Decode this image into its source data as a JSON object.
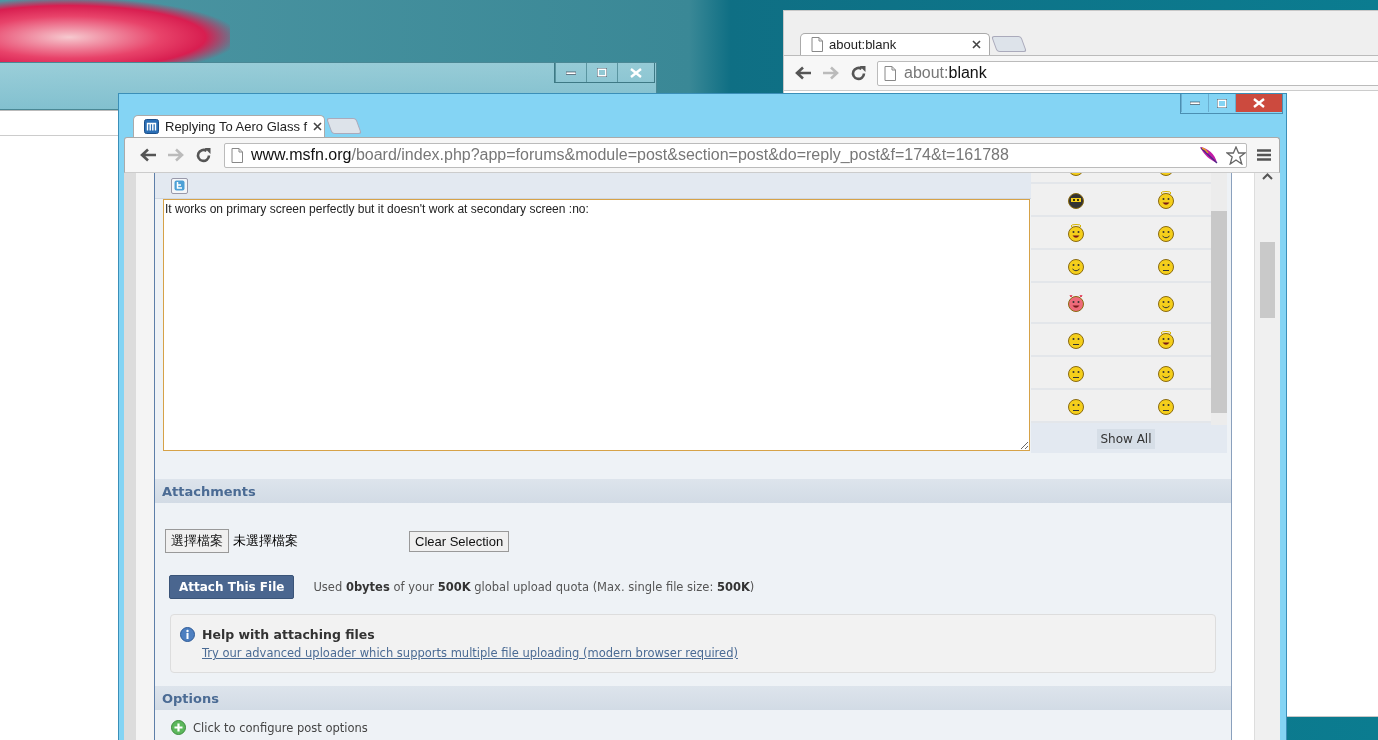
{
  "blank_window": {
    "tab": {
      "title": "about:blank",
      "selected": true
    },
    "address": {
      "scheme": "about:",
      "rest": "blank"
    }
  },
  "main_window": {
    "tab": {
      "title": "Replying To Aero Glass f",
      "selected": true
    },
    "address": {
      "host": "www.msfn.org",
      "path": "/board/index.php?app=forums&module=post&section=post&do=reply_post&f=174&t=161788"
    }
  },
  "editor": {
    "value": "It works on primary screen perfectly but it doesn't work at secondary screen :no: ",
    "focused": true
  },
  "emoticons": {
    "show_all": "Show All"
  },
  "attachments": {
    "heading": "Attachments",
    "choose_button": "選擇檔案",
    "no_file": "未選擇檔案",
    "clear_button": "Clear Selection",
    "attach_button": "Attach This File",
    "quota": "Used **0bytes** of your **500K** global upload quota (Max. single file size: **500K**)",
    "help": {
      "title": "Help with attaching files",
      "link": "Try our advanced uploader which supports multiple file uploading (modern browser required)"
    }
  },
  "options": {
    "heading": "Options",
    "configure": "Click to configure post options"
  }
}
